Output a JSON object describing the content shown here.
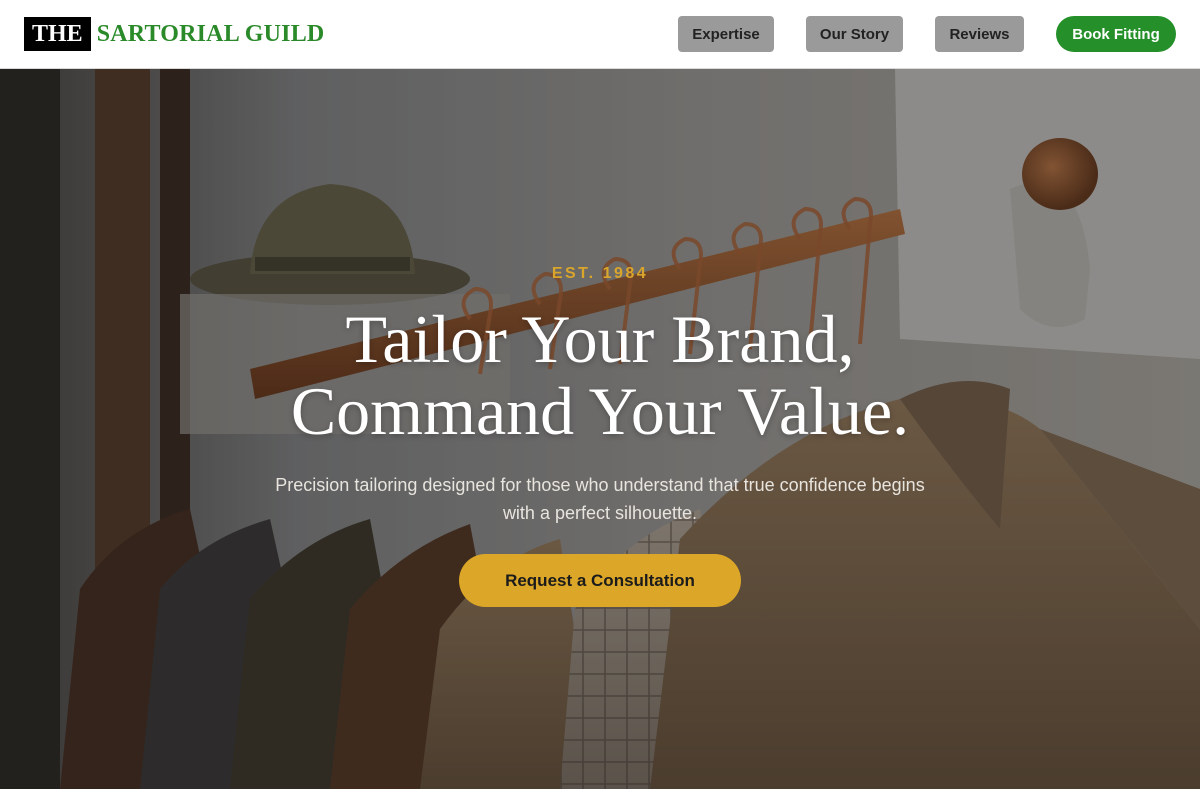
{
  "header": {
    "logo": {
      "mark": "THE",
      "name": "SARTORIAL GUILD"
    },
    "nav": [
      {
        "label": "Expertise"
      },
      {
        "label": "Our Story"
      },
      {
        "label": "Reviews"
      }
    ],
    "book_label": "Book Fitting"
  },
  "hero": {
    "eyebrow": "EST. 1984",
    "headline_line1": "Tailor Your Brand,",
    "headline_line2": "Command Your Value.",
    "subhead": "Precision tailoring designed for those who understand that true confidence begins with a perfect silhouette.",
    "cta_label": "Request a Consultation",
    "background": "photo of tailored jackets on copper hangers with a felt hat on a shelf"
  },
  "colors": {
    "brand_green": "#25902a",
    "logo_green": "#2a8a2a",
    "accent_gold": "#dca728",
    "nav_gray": "#9a9a9a"
  }
}
